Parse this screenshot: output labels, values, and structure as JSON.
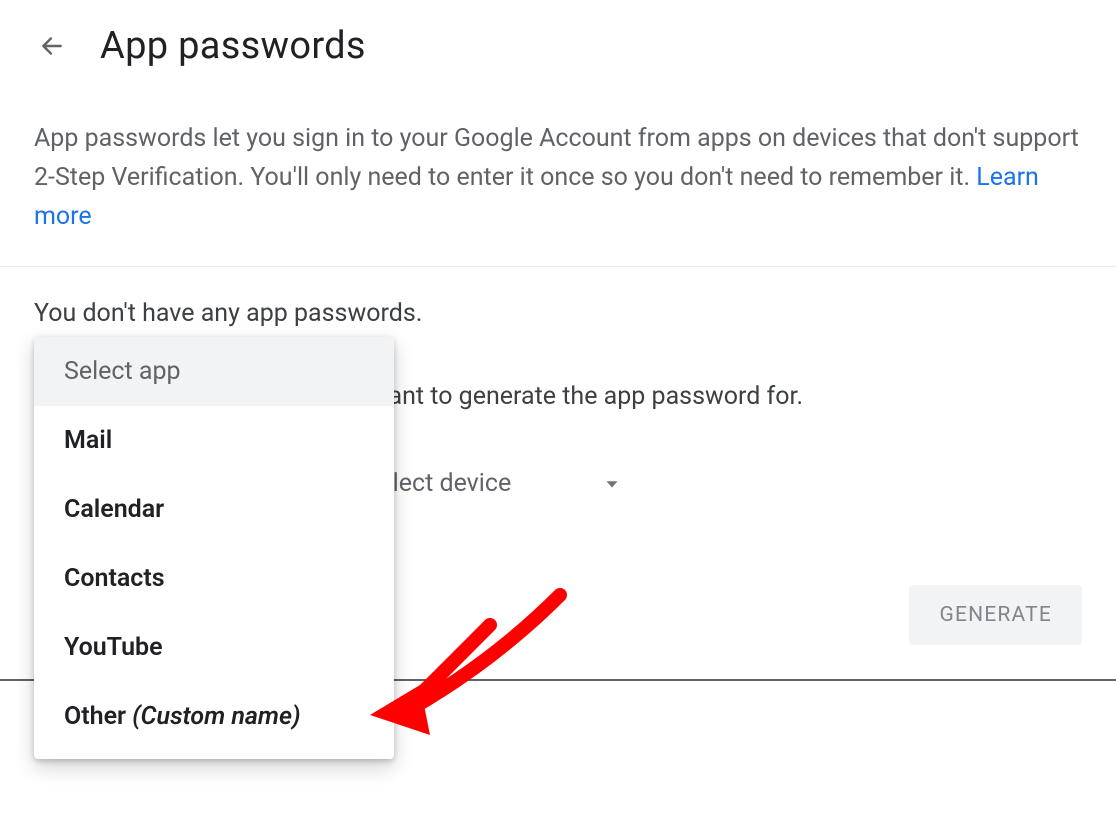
{
  "header": {
    "title": "App passwords"
  },
  "description": {
    "text": "App passwords let you sign in to your Google Account from apps on devices that don't support 2-Step Verification. You'll only need to enter it once so you don't need to remember it. ",
    "learn_more": "Learn more"
  },
  "content": {
    "no_passwords": "You don't have any app passwords.",
    "instruction": "Select the app and device you want to generate the app password for.",
    "select_device_label": "Select device",
    "generate_label": "GENERATE"
  },
  "dropdown": {
    "header": "Select app",
    "options": [
      {
        "label": "Mail"
      },
      {
        "label": "Calendar"
      },
      {
        "label": "Contacts"
      },
      {
        "label": "YouTube"
      },
      {
        "label": "Other ",
        "sublabel": "(Custom name)"
      }
    ]
  }
}
